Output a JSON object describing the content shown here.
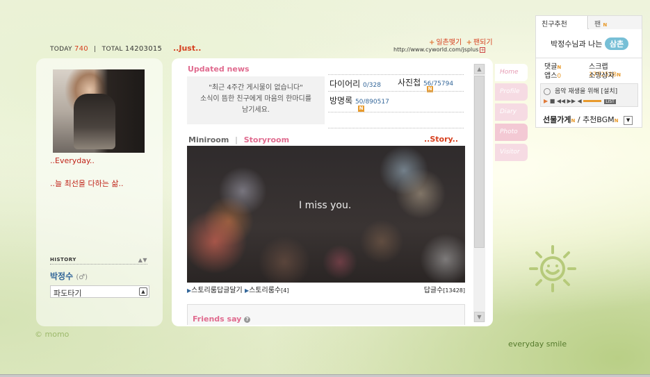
{
  "counter": {
    "today_label": "TODAY",
    "today_value": "740",
    "total_label": "TOTAL",
    "total_value": "14203015"
  },
  "profile": {
    "everyday_text": "..Everyday..",
    "motto_text": "..늘 최선을 다하는 삶..",
    "history_label": "HISTORY",
    "owner_name": "박정수",
    "owner_gender": "(♂)",
    "wave_select_value": "파도타기"
  },
  "brand": {
    "momo": "© momo"
  },
  "header": {
    "title": "..Just..",
    "link_ilchon": "일촌맺기",
    "link_fan": "팬되기",
    "url": "http://www.cyworld.com/jsplus"
  },
  "updated_news": {
    "title": "Updated news",
    "message_line1": "\"최근 4주간 게시물이 없습니다\"",
    "message_line2": "소식이 뜸한 친구에게 마음의 한마디를",
    "message_line3": "남기세요."
  },
  "stats": {
    "diary_label": "다이어리",
    "diary_value": "0/328",
    "photo_label": "사진첩",
    "photo_value": "56/75794",
    "guestbook_label": "방명록",
    "guestbook_value": "50/890517",
    "new_badge": "N"
  },
  "miniroom": {
    "tab_miniroom": "Miniroom",
    "tab_separator": "|",
    "tab_storyroom": "Storyroom",
    "story_label": "..Story..",
    "image_caption": "I miss you.",
    "footer_link1": "스토리룸답글달기",
    "footer_link2": "스토리룸수",
    "footer_link2_count": "[4]",
    "footer_reply_label": "답글수",
    "footer_reply_count": "[13428]"
  },
  "friends_say": {
    "title": "Friends say"
  },
  "menu_tabs": [
    "Home",
    "Profile",
    "Diary",
    "Photo",
    "Visitor"
  ],
  "sidebar": {
    "tab_recommend": "친구추천",
    "tab_fan": "팬",
    "relation_text": "박정수님과 나는",
    "relation_badge": "삼촌",
    "reply_label": "댓글",
    "scrap_label": "스크랩",
    "scrap_value": "1752528",
    "apps_label": "앱스",
    "apps_value": "0",
    "wish_label": "소망상자",
    "music_text": "음악 재생을 위해 [설치]",
    "list_button": "LIST",
    "gift_label": "선물가게",
    "bgm_label": "추천BGM",
    "separator": "/"
  },
  "footer": {
    "everyday_smile": "everyday smile"
  },
  "colors": {
    "accent_red": "#d6401f",
    "accent_pink": "#e06b8f",
    "link_blue": "#336699",
    "badge_orange": "#e89a2c"
  }
}
